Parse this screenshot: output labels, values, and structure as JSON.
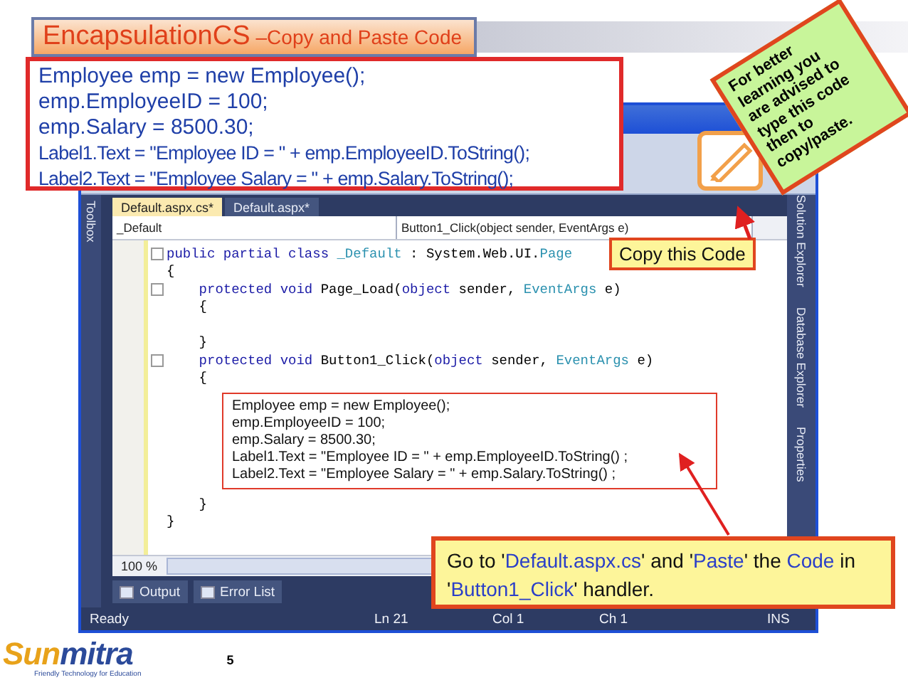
{
  "slide_title": {
    "main": "EncapsulationCS",
    "sub": "–Copy and Paste Code"
  },
  "code_box": {
    "lines": [
      {
        "text": "Employee emp = new Employee();",
        "kind": "regular"
      },
      {
        "text": "emp.EmployeeID = 100;",
        "kind": "regular"
      },
      {
        "text": "emp.Salary = 8500.30;",
        "kind": "regular"
      },
      {
        "text": "Label1.Text = \"Employee ID = \" + emp.EmployeeID.ToString();",
        "kind": "condensed"
      },
      {
        "text": "Label2.Text = \"Employee Salary = \" + emp.Salary.ToString();",
        "kind": "condensed"
      }
    ]
  },
  "note": {
    "lines": [
      "For better",
      "learning you",
      "are advised to",
      "type this code",
      "then to",
      "copy/paste."
    ]
  },
  "ide": {
    "side_left": "Toolbox",
    "side_right": [
      "Solution Explorer",
      "Database Explorer",
      "Properties"
    ],
    "tabs": [
      {
        "label": "Default.aspx.cs*",
        "selected": true
      },
      {
        "label": "Default.aspx*",
        "selected": false
      }
    ],
    "class_dropdown": "_Default",
    "member_dropdown": "Button1_Click(object sender, EventArgs e)",
    "code_before": [
      {
        "fold": true,
        "tokens": [
          {
            "text": "public partial class ",
            "kind": "keyword"
          },
          {
            "text": "_Default",
            "kind": "type"
          },
          {
            "text": " : System.Web.UI.",
            "kind": "plain"
          },
          {
            "text": "Page",
            "kind": "type"
          }
        ]
      },
      {
        "fold": false,
        "tokens": [
          {
            "text": "{",
            "kind": "plain"
          }
        ]
      },
      {
        "fold": true,
        "tokens": [
          {
            "text": "    protected void ",
            "kind": "keyword"
          },
          {
            "text": "Page_Load(",
            "kind": "plain"
          },
          {
            "text": "object",
            "kind": "keyword"
          },
          {
            "text": " sender, ",
            "kind": "plain"
          },
          {
            "text": "EventArgs",
            "kind": "type"
          },
          {
            "text": " e)",
            "kind": "plain"
          }
        ]
      },
      {
        "fold": false,
        "tokens": [
          {
            "text": "    {",
            "kind": "plain"
          }
        ]
      },
      {
        "kind": "blank"
      },
      {
        "fold": false,
        "tokens": [
          {
            "text": "    }",
            "kind": "plain"
          }
        ]
      },
      {
        "fold": true,
        "tokens": [
          {
            "text": "    protected void ",
            "kind": "keyword"
          },
          {
            "text": "Button1_Click(",
            "kind": "plain"
          },
          {
            "text": "object",
            "kind": "keyword"
          },
          {
            "text": " sender, ",
            "kind": "plain"
          },
          {
            "text": "EventArgs",
            "kind": "type"
          },
          {
            "text": " e)",
            "kind": "plain"
          }
        ]
      },
      {
        "fold": false,
        "tokens": [
          {
            "text": "    {",
            "kind": "plain"
          }
        ]
      }
    ],
    "pasted_lines": [
      "Employee emp = new Employee();",
      "emp.EmployeeID = 100;",
      "emp.Salary = 8500.30;",
      "Label1.Text = \"Employee ID = \" + emp.EmployeeID.ToString() ;",
      "Label2.Text = \"Employee Salary = \" + emp.Salary.ToString() ;"
    ],
    "code_after": [
      {
        "fold": false,
        "tokens": [
          {
            "text": "    }",
            "kind": "plain"
          }
        ]
      },
      {
        "fold": false,
        "tokens": [
          {
            "text": "}",
            "kind": "plain"
          }
        ]
      }
    ],
    "zoom": "100 %",
    "panel_tabs": [
      "Output",
      "Error List"
    ],
    "status": [
      "Ready",
      "Ln 21",
      "Col 1",
      "Ch 1",
      "INS"
    ]
  },
  "callout_copy": "Copy this Code",
  "callout_paste": [
    {
      "text": "Go to '",
      "highlight": false
    },
    {
      "text": "Default.aspx.cs",
      "highlight": true
    },
    {
      "text": "' and '",
      "highlight": false
    },
    {
      "text": "Paste",
      "highlight": true
    },
    {
      "text": "' the ",
      "highlight": false
    },
    {
      "text": "Code",
      "highlight": true
    },
    {
      "text": " in '",
      "highlight": false
    },
    {
      "text": "Button1_Click",
      "highlight": true
    },
    {
      "text": "' handler.",
      "highlight": false
    }
  ],
  "logo": {
    "name_part1": "Sun",
    "name_part2": "mitra",
    "tagline": "Friendly Technology for Education"
  },
  "page_number": "5"
}
